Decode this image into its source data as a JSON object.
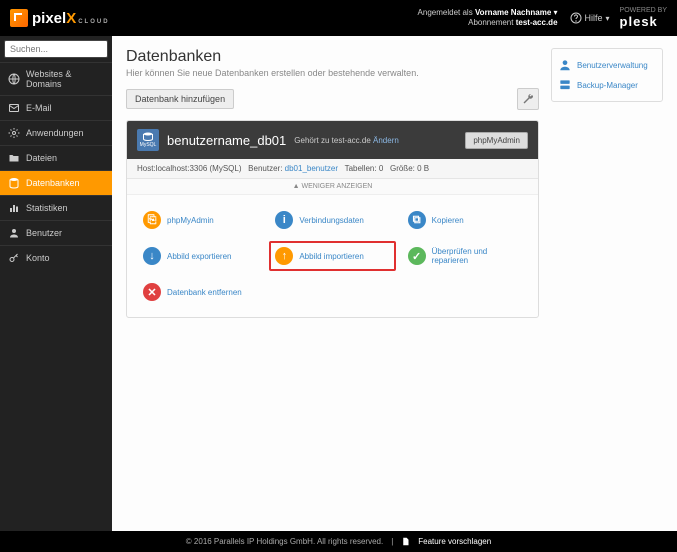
{
  "brand": {
    "name": "pixel",
    "accent": "X",
    "sub": "CLOUD"
  },
  "header": {
    "logged_in_as": "Angemeldet als",
    "user_name": "Vorname Nachname",
    "subscription_label": "Abonnement",
    "subscription": "test-acc.de",
    "help": "Hilfe",
    "powered": "POWERED BY",
    "powered_brand": "plesk"
  },
  "search": {
    "placeholder": "Suchen..."
  },
  "nav": [
    {
      "label": "Websites & Domains",
      "icon": "globe"
    },
    {
      "label": "E-Mail",
      "icon": "mail"
    },
    {
      "label": "Anwendungen",
      "icon": "gear"
    },
    {
      "label": "Dateien",
      "icon": "folder"
    },
    {
      "label": "Datenbanken",
      "icon": "db",
      "active": true
    },
    {
      "label": "Statistiken",
      "icon": "stats"
    },
    {
      "label": "Benutzer",
      "icon": "user"
    },
    {
      "label": "Konto",
      "icon": "key"
    }
  ],
  "page": {
    "title": "Datenbanken",
    "subtitle": "Hier können Sie neue Datenbanken erstellen oder bestehende verwalten.",
    "add_btn": "Datenbank hinzufügen"
  },
  "db": {
    "name": "benutzername_db01",
    "belongs_prefix": "Gehört zu",
    "belongs_domain": "test-acc.de",
    "change": "Ändern",
    "php_btn": "phpMyAdmin",
    "host_label": "Host:",
    "host": "localhost:3306 (MySQL)",
    "user_label": "Benutzer:",
    "user": "db01_benutzer",
    "tables_label": "Tabellen:",
    "tables": "0",
    "size_label": "Größe:",
    "size": "0 B",
    "toggle": "WENIGER ANZEIGEN"
  },
  "actions": [
    {
      "label": "phpMyAdmin",
      "color": "#f90",
      "glyph": "⎘"
    },
    {
      "label": "Verbindungsdaten",
      "color": "#3a87c7",
      "glyph": "i"
    },
    {
      "label": "Kopieren",
      "color": "#3a87c7",
      "glyph": "⧉"
    },
    {
      "label": "Abbild exportieren",
      "color": "#3a87c7",
      "glyph": "↓"
    },
    {
      "label": "Abbild importieren",
      "color": "#f90",
      "glyph": "↑",
      "highlight": true
    },
    {
      "label": "Überprüfen und reparieren",
      "color": "#5cb85c",
      "glyph": "✓"
    },
    {
      "label": "Datenbank entfernen",
      "color": "#e04040",
      "glyph": "✕"
    }
  ],
  "sidepanel": [
    {
      "label": "Benutzerverwaltung",
      "icon": "user"
    },
    {
      "label": "Backup-Manager",
      "icon": "backup"
    }
  ],
  "footer": {
    "copyright": "© 2016 Parallels IP Holdings GmbH. All rights reserved.",
    "feature": "Feature vorschlagen"
  }
}
